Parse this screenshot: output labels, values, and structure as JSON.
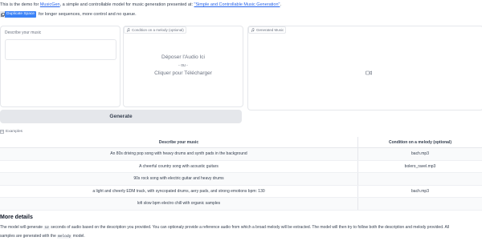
{
  "intro": {
    "prefix": "This is the demo for ",
    "link1": "MusicGen",
    "middle": ", a simple and controllable model for music generation presented at: ",
    "link2": "\"Simple and Controllable Music Generation\"",
    "suffix": "."
  },
  "duplicate": {
    "badge_label": "Duplicate Space",
    "text": "for longer sequences, more control and no queue."
  },
  "input": {
    "label": "Describe your music",
    "value": ""
  },
  "melody": {
    "label": "Condition on a melody (optional)",
    "drop_text": "Déposer l'Audio Ici",
    "or_text": "- ou -",
    "click_text": "Cliquer pour Télécharger"
  },
  "output": {
    "label": "Generated Music"
  },
  "generate_label": "Generate",
  "examples": {
    "label": "Examples",
    "headers": [
      "Describe your music",
      "Condition on a melody (optional)"
    ],
    "rows": [
      {
        "desc": "An 80s driving pop song with heavy drums and synth pads in the background",
        "melody": "bach.mp3"
      },
      {
        "desc": "A cheerful country song with acoustic guitars",
        "melody": "bolero_ravel.mp3"
      },
      {
        "desc": "90s rock song with electric guitar and heavy drums",
        "melody": ""
      },
      {
        "desc": "a light and cheerly EDM track, with syncopated drums, aery pads, and strong emotions bpm: 130",
        "melody": "bach.mp3"
      },
      {
        "desc": "lofi slow bpm electro chill with organic samples",
        "melody": ""
      }
    ]
  },
  "more": {
    "title": "More details",
    "line1_a": "The model will generate ",
    "line1_code": "12",
    "line1_b": " seconds of audio based on the description you provided. You can optionaly provide a reference audio from which a broad melody will be extracted. The model will then try to follow both the description and melody provided. All",
    "line2_a": "samples are generated with the ",
    "line2_code": "melody",
    "line2_b": " model."
  },
  "colors": {
    "link": "#2563eb",
    "badge": "#3b82f6",
    "button_bg": "#e5e7eb"
  },
  "icons": [
    "duplicate-icon",
    "music-icon",
    "examples-icon",
    "video-icon"
  ]
}
